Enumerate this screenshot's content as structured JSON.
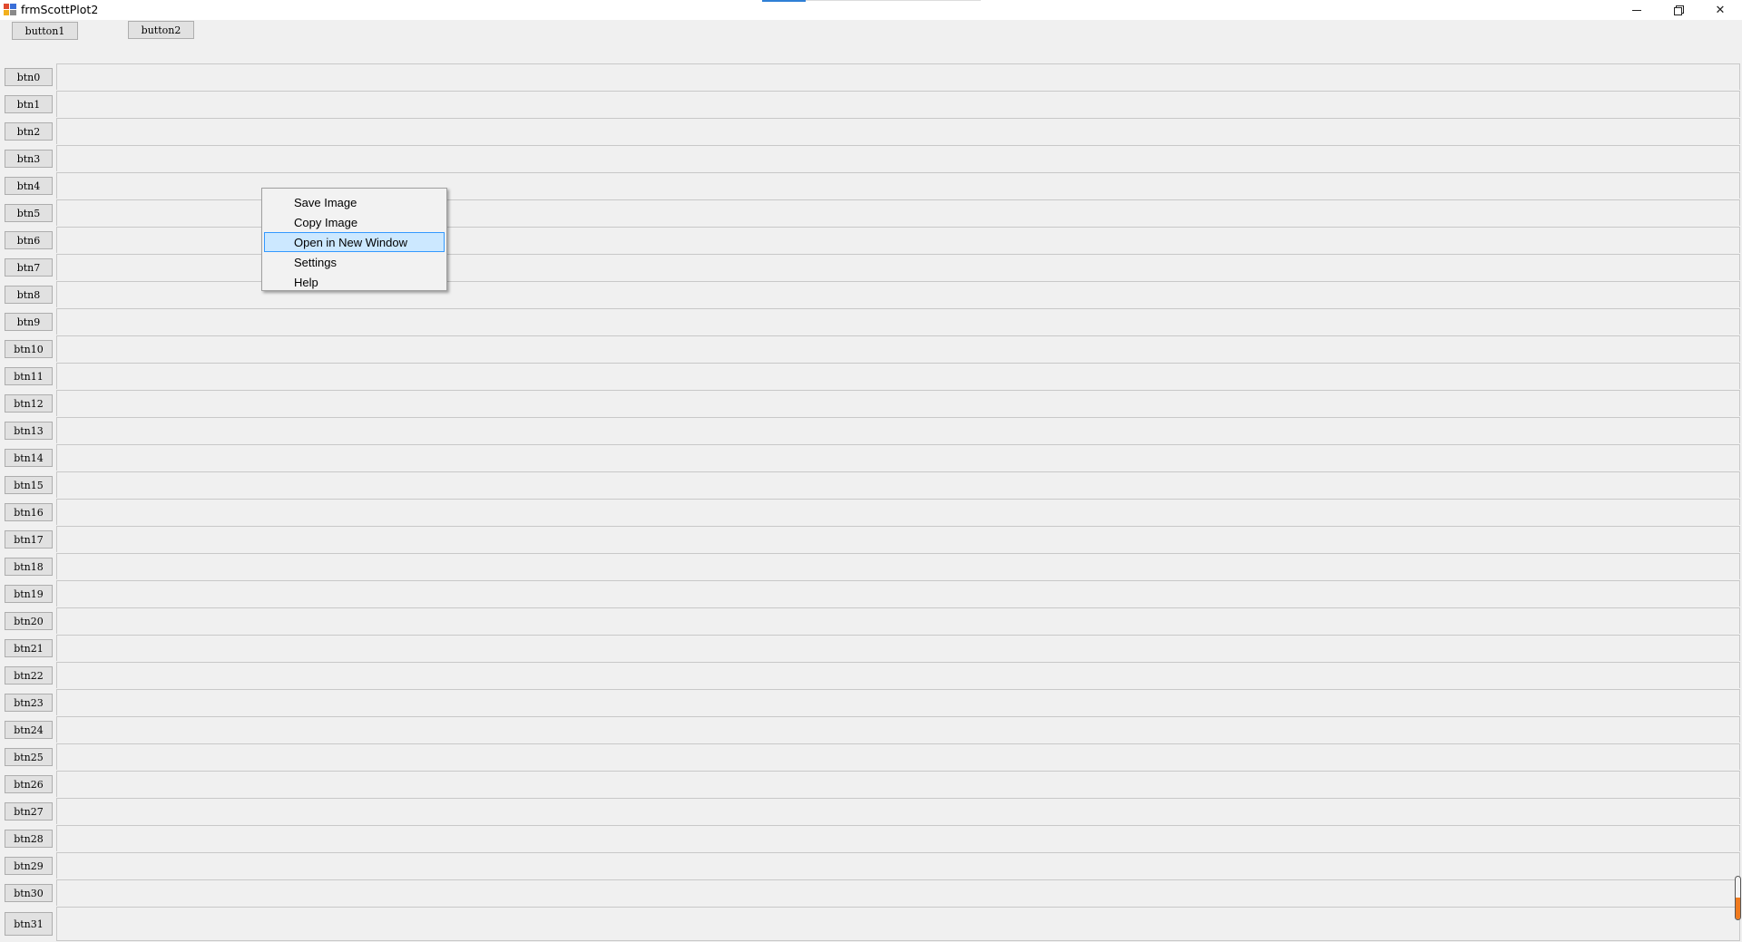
{
  "window": {
    "title": "frmScottPlot2"
  },
  "toolbar": {
    "button1_label": "button1",
    "button2_label": "button2"
  },
  "rows": [
    "btn0",
    "btn1",
    "btn2",
    "btn3",
    "btn4",
    "btn5",
    "btn6",
    "btn7",
    "btn8",
    "btn9",
    "btn10",
    "btn11",
    "btn12",
    "btn13",
    "btn14",
    "btn15",
    "btn16",
    "btn17",
    "btn18",
    "btn19",
    "btn20",
    "btn21",
    "btn22",
    "btn23",
    "btn24",
    "btn25",
    "btn26",
    "btn27",
    "btn28",
    "btn29",
    "btn30",
    "btn31"
  ],
  "context_menu": {
    "items": [
      {
        "label": "Save Image",
        "selected": false
      },
      {
        "label": "Copy Image",
        "selected": false
      },
      {
        "label": "Open in New Window",
        "selected": true
      },
      {
        "label": "Settings",
        "selected": false
      },
      {
        "label": "Help",
        "selected": false
      }
    ]
  },
  "colors": {
    "window_bg": "#f0f0f0",
    "menu_highlight": "#cce8ff",
    "menu_highlight_border": "#3399ff",
    "scroll_accent": "#f07a1e"
  },
  "icons": {
    "app": "app-icon",
    "minimize": "minimize-icon",
    "maximize": "restore-icon",
    "close": "close-icon"
  }
}
